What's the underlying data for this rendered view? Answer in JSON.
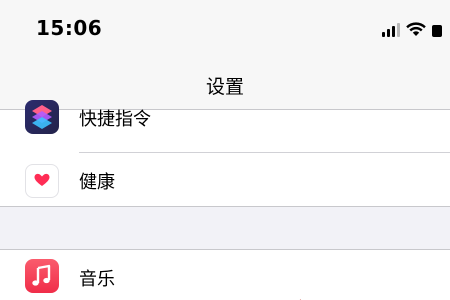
{
  "status_bar": {
    "time": "15:06",
    "signal_icon": "cellular-signal-icon",
    "wifi_icon": "wifi-icon",
    "battery_icon": "battery-icon"
  },
  "nav": {
    "title": "设置"
  },
  "settings": {
    "group_1": [
      {
        "label": "快捷指令",
        "icon": "shortcuts-icon"
      },
      {
        "label": "健康",
        "icon": "health-heart-icon"
      }
    ],
    "group_2": [
      {
        "label": "音乐",
        "icon": "music-note-icon"
      }
    ]
  },
  "colors": {
    "background": "#f2f2f7",
    "bar_background": "#f7f7f7",
    "health_heart": "#ff2d55",
    "music_icon": "#f02d49",
    "shortcuts_icon": "#2c2c6e"
  }
}
